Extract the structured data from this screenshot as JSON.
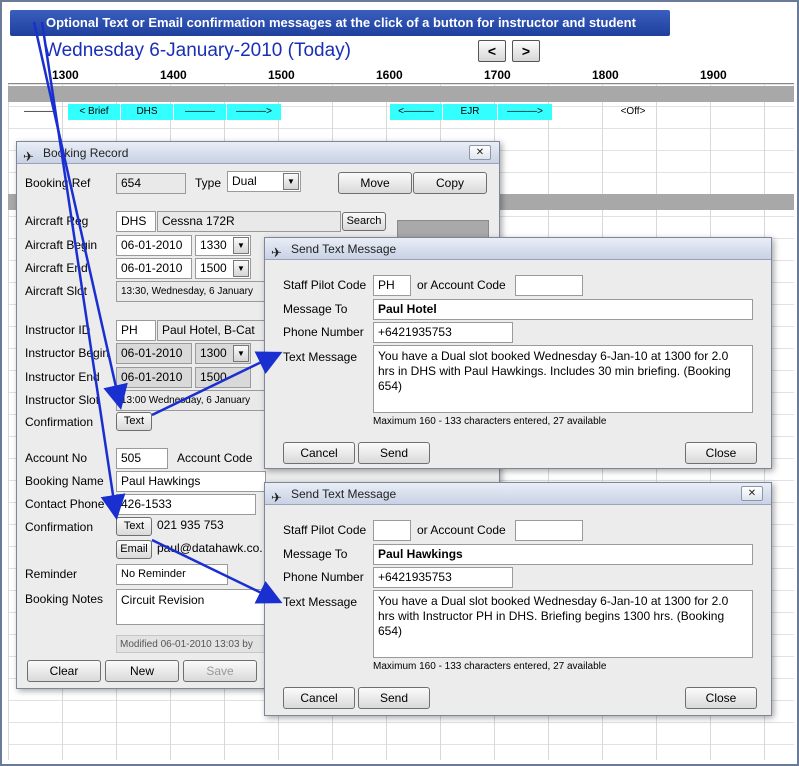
{
  "banner": "Optional Text or Email confirmation messages at the click of a button for instructor and student",
  "date_title": "Wednesday 6-January-2010  (Today)",
  "nav": {
    "prev": "<",
    "next": ">"
  },
  "timeline": [
    "1300",
    "1400",
    "1500",
    "1600",
    "1700",
    "1800",
    "1900"
  ],
  "slots": [
    {
      "text": "———",
      "cyan": false
    },
    {
      "text": "< Brief",
      "cyan": true
    },
    {
      "text": "DHS",
      "cyan": true
    },
    {
      "text": "———",
      "cyan": true
    },
    {
      "text": "———>",
      "cyan": true
    },
    {
      "text": "<———",
      "cyan": true
    },
    {
      "text": "EJR",
      "cyan": true
    },
    {
      "text": "———>",
      "cyan": true
    },
    {
      "text": "<Off>",
      "cyan": false
    }
  ],
  "booking": {
    "title": "Booking Record",
    "ref_label": "Booking Ref",
    "ref": "654",
    "type_label": "Type",
    "type": "Dual",
    "move": "Move",
    "copy": "Copy",
    "aircraft_reg_label": "Aircraft Reg",
    "aircraft_reg": "DHS",
    "aircraft_model": "Cessna 172R",
    "search": "Search",
    "aircraft_begin_label": "Aircraft Begin",
    "aircraft_begin_date": "06-01-2010",
    "aircraft_begin_time": "1330",
    "aircraft_end_label": "Aircraft End",
    "aircraft_end_date": "06-01-2010",
    "aircraft_end_time": "1500",
    "aircraft_slot_label": "Aircraft Slot",
    "aircraft_slot": "13:30, Wednesday, 6 January",
    "instructor_id_label": "Instructor ID",
    "instructor_id": "PH",
    "instructor_name": "Paul Hotel, B-Cat",
    "instructor_begin_label": "Instructor Begin",
    "instructor_begin_date": "06-01-2010",
    "instructor_begin_time": "1300",
    "instructor_end_label": "Instructor End",
    "instructor_end_date": "06-01-2010",
    "instructor_end_time": "1500",
    "instructor_slot_label": "Instructor Slot",
    "instructor_slot": "13:00 Wednesday, 6 January",
    "confirmation_label": "Confirmation",
    "text_btn": "Text",
    "account_no_label": "Account No",
    "account_no": "505",
    "account_code_label": "Account Code",
    "booking_name_label": "Booking Name",
    "booking_name": "Paul Hawkings",
    "contact_phone_label": "Contact Phone",
    "contact_phone": "426-1533",
    "confirmation2_label": "Confirmation",
    "text_btn2": "Text",
    "mobile": "021 935 753",
    "email_btn": "Email",
    "email": "paul@datahawk.co.",
    "reminder_label": "Reminder",
    "reminder": "No Reminder",
    "notes_label": "Booking Notes",
    "notes": "Circuit Revision",
    "modified": "Modified 06-01-2010 13:03 by",
    "clear": "Clear",
    "new": "New",
    "save": "Save"
  },
  "sms1": {
    "title": "Send Text Message",
    "staff_label": "Staff Pilot Code",
    "staff": "PH",
    "or_account_label": "or Account Code",
    "account": "",
    "to_label": "Message To",
    "to": "Paul Hotel",
    "phone_label": "Phone Number",
    "phone": "+6421935753",
    "msg_label": "Text Message",
    "msg": "You have a Dual slot booked Wednesday 6-Jan-10 at 1300 for 2.0 hrs in DHS with Paul Hawkings. Includes 30 min briefing. (Booking 654)",
    "count": "Maximum 160 - 133 characters entered, 27 available",
    "cancel": "Cancel",
    "send": "Send",
    "close": "Close"
  },
  "sms2": {
    "title": "Send Text Message",
    "staff_label": "Staff Pilot Code",
    "staff": "",
    "or_account_label": "or Account Code",
    "account": "",
    "to_label": "Message To",
    "to": "Paul Hawkings",
    "phone_label": "Phone Number",
    "phone": "+6421935753",
    "msg_label": "Text Message",
    "msg": "You have a Dual slot booked Wednesday 6-Jan-10 at 1300 for 2.0 hrs with Instructor PH in DHS. Briefing begins 1300 hrs. (Booking 654)",
    "count": "Maximum 160 - 133 characters entered, 27 available",
    "cancel": "Cancel",
    "send": "Send",
    "close": "Close"
  },
  "colors": {
    "banner": "#1e3f9c",
    "date": "#1a2fb8",
    "slot_cyan": "#33ffff",
    "arrow": "#1a2fd0"
  }
}
